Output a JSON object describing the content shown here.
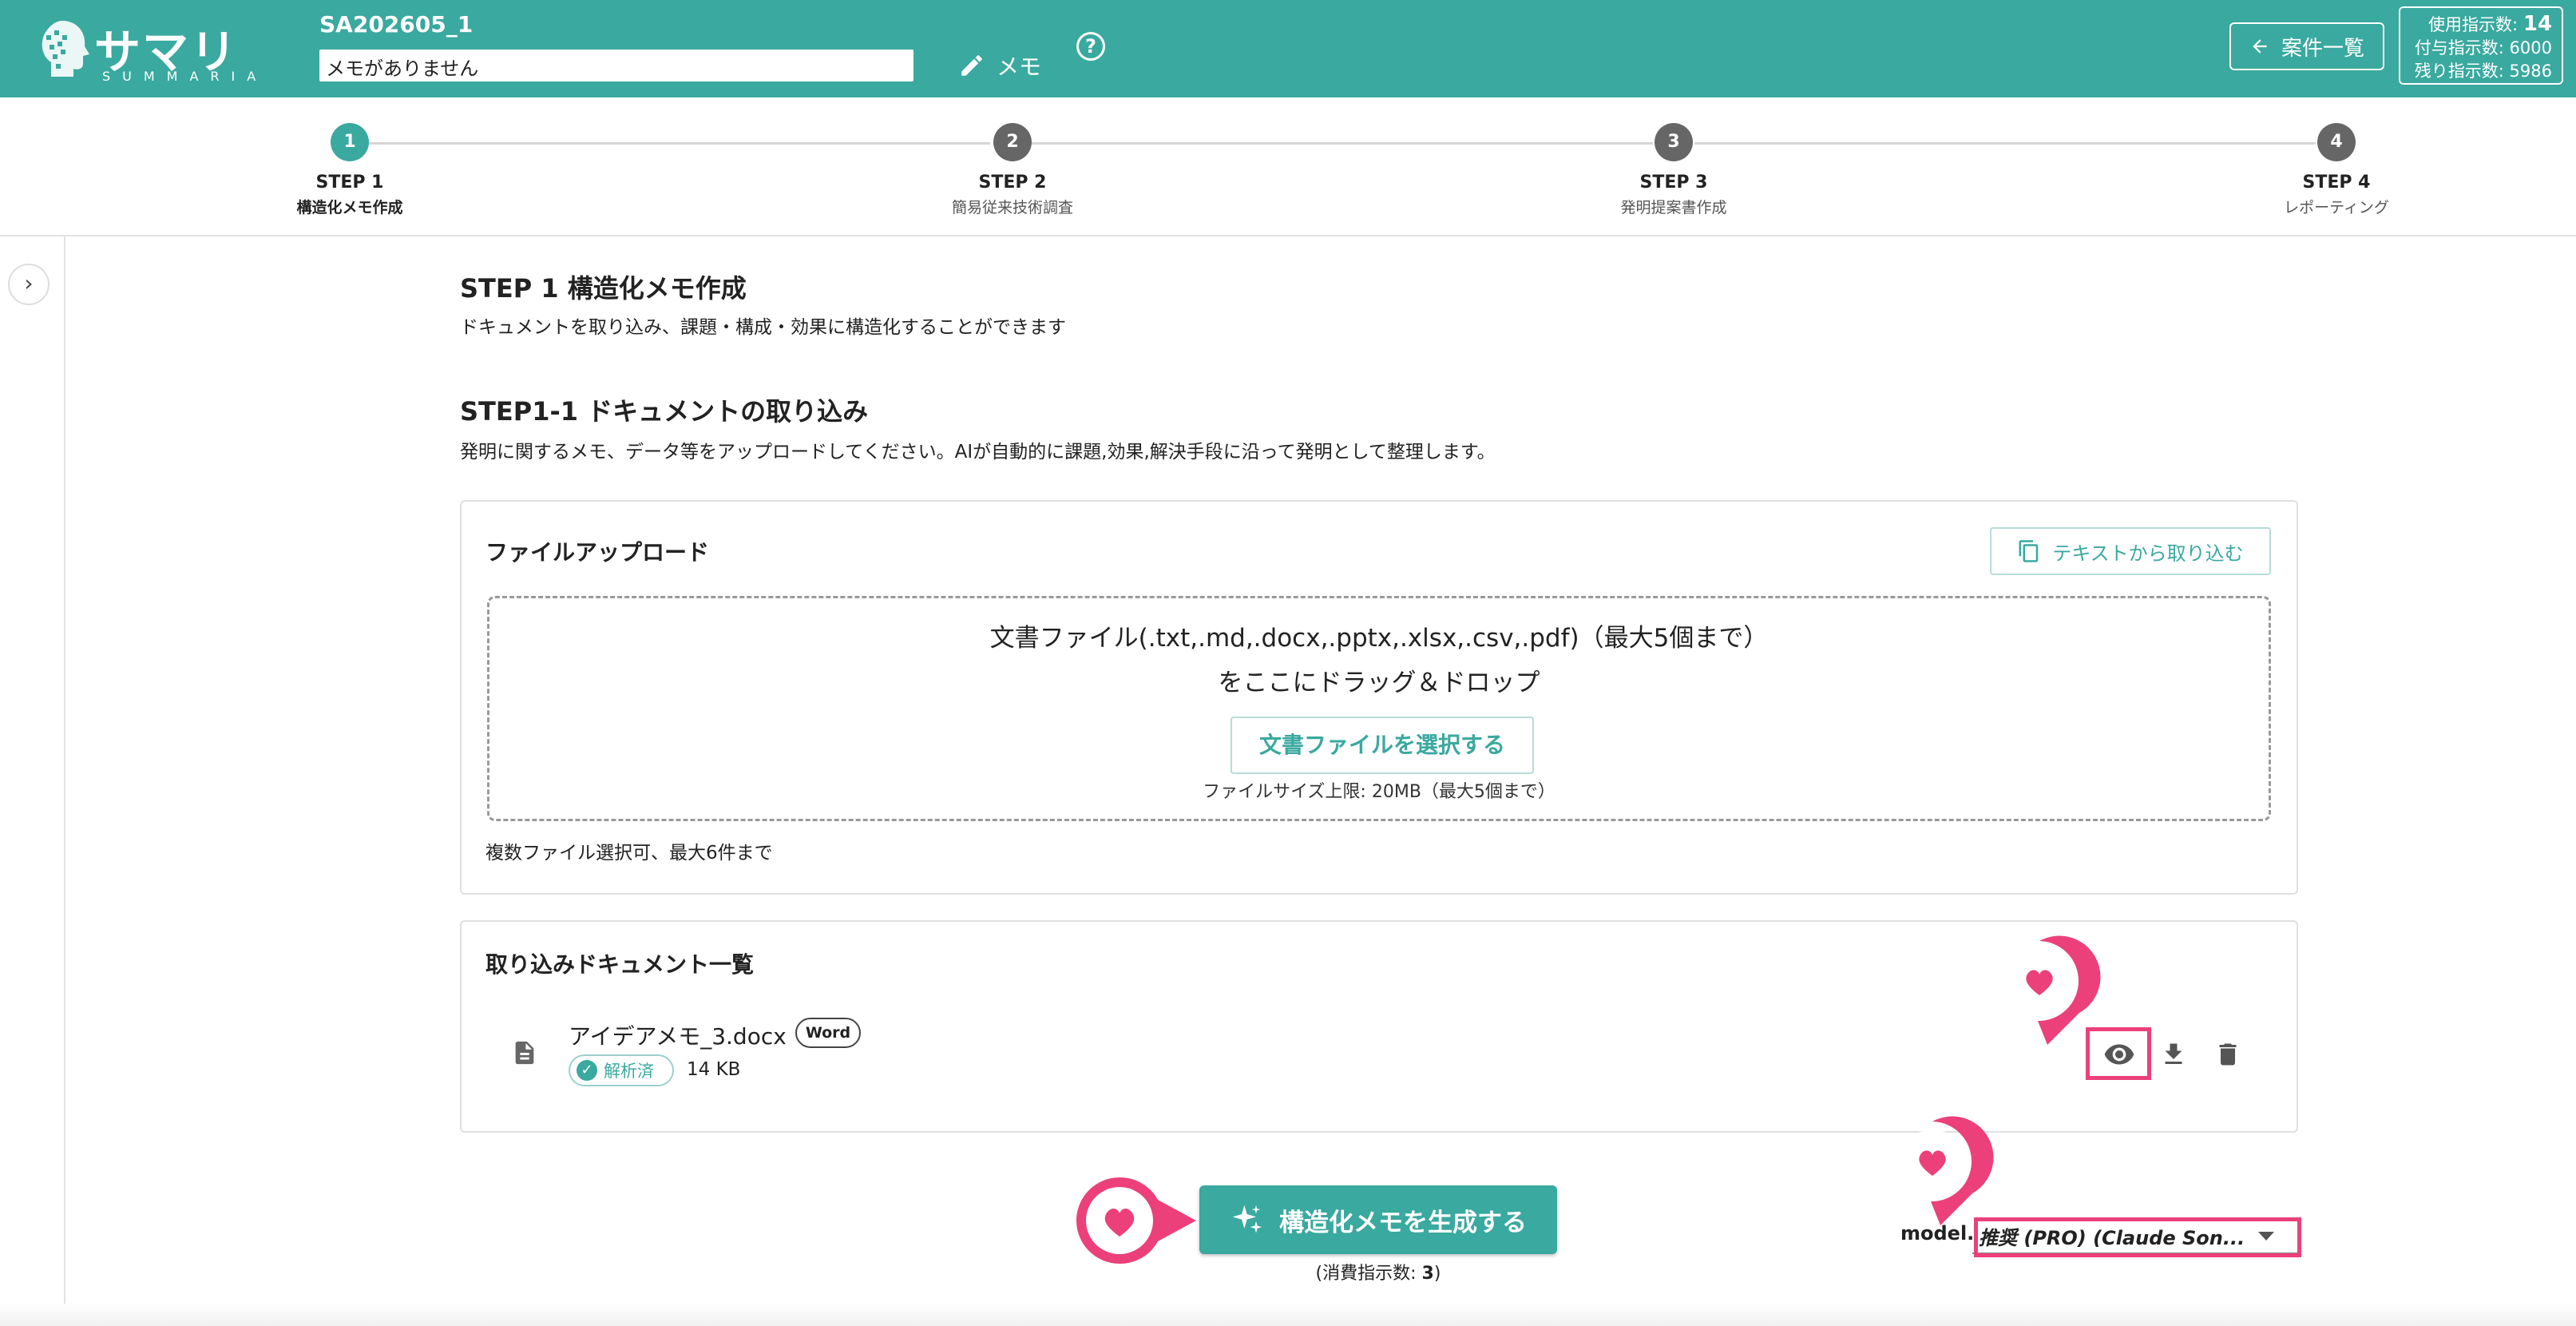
{
  "header": {
    "logo_jp": "サマリア",
    "logo_en": "SUMMARIA",
    "case_id": "SA202605_1",
    "memo_value": "メモがありません",
    "memo_button": "メモ",
    "help_glyph": "?",
    "case_list_button": "案件一覧",
    "credits": {
      "used_label": "使用指示数:",
      "used_value": "14",
      "granted": "付与指示数: 6000",
      "remaining": "残り指示数: 5986"
    }
  },
  "stepper": {
    "steps": [
      {
        "num": "1",
        "title": "STEP 1",
        "sub": "構造化メモ作成",
        "active": true
      },
      {
        "num": "2",
        "title": "STEP 2",
        "sub": "簡易従来技術調査",
        "active": false
      },
      {
        "num": "3",
        "title": "STEP 3",
        "sub": "発明提案書作成",
        "active": false
      },
      {
        "num": "4",
        "title": "STEP 4",
        "sub": "レポーティング",
        "active": false
      }
    ]
  },
  "sidebar": {
    "toggle_glyph": "›"
  },
  "main": {
    "step_title": "STEP 1 構造化メモ作成",
    "step_desc": "ドキュメントを取り込み、課題・構成・効果に構造化することができます",
    "section_title": "STEP1-1 ドキュメントの取り込み",
    "section_desc": "発明に関するメモ、データ等をアップロードしてください。AIが自動的に課題,効果,解決手段に沿って発明として整理します。",
    "upload": {
      "title": "ファイルアップロード",
      "text_import_button": "テキストから取り込む",
      "drop_line1": "文書ファイル(.txt,.md,.docx,.pptx,.xlsx,.csv,.pdf)（最大5個まで）",
      "drop_line2": "をここにドラッグ＆ドロップ",
      "select_button": "文書ファイルを選択する",
      "size_limit": "ファイルサイズ上限: 20MB（最大5個まで）",
      "multi_note": "複数ファイル選択可、最大6件まで"
    },
    "documents": {
      "title": "取り込みドキュメント一覧",
      "items": [
        {
          "name": "アイデアメモ_3.docx",
          "type_badge": "Word",
          "status": "解析済",
          "size": "14 KB"
        }
      ]
    },
    "generate_button": "構造化メモを生成する",
    "cost_prefix": "(消費指示数: ",
    "cost_value": "3",
    "cost_suffix": ")",
    "model_label": "model.",
    "model_selected": "推奨 (PRO) (Claude Son..."
  },
  "colors": {
    "brand": "#3aa99f",
    "highlight": "#ec407a",
    "inactive_step": "#666666"
  },
  "icons": [
    "pencil-icon",
    "help-icon",
    "arrow-left-icon",
    "chevron-right-icon",
    "copy-icon",
    "document-icon",
    "check-circle-icon",
    "eye-icon",
    "download-icon",
    "trash-icon",
    "sparkle-icon",
    "caret-down-icon",
    "heart-pin-icon"
  ]
}
